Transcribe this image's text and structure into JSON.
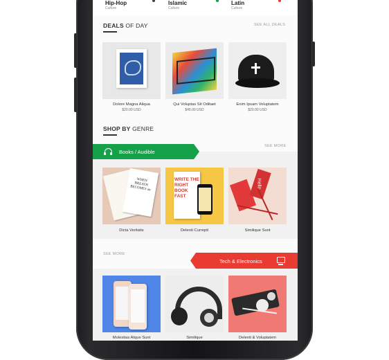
{
  "categories": [
    {
      "title": "Hip-Hop",
      "sub": "Culture"
    },
    {
      "title": "Islamic",
      "sub": "Culture"
    },
    {
      "title": "Latin",
      "sub": "Culture"
    }
  ],
  "deals": {
    "title_bold": "DEALS",
    "title_rest": "OF DAY",
    "see_all": "SEE ALL DEALS",
    "items": [
      {
        "name": "Dolore Magna Aliqua",
        "price": "$20.00 USD"
      },
      {
        "name": "Qui Voluptas Sit Oditaet",
        "price": "$45.00 USD"
      },
      {
        "name": "Enim Ipsam Voluptatem",
        "price": "$20.00 USD"
      }
    ]
  },
  "genre": {
    "title_bold": "SHOP BY",
    "title_rest": "GENRE",
    "books": {
      "label": "Books / Audible",
      "see_more": "SEE MORE",
      "items": [
        {
          "name": "Dicta Veritatis",
          "cover_text": "WHEN BREATH BECOMES air"
        },
        {
          "name": "Delenti Currepti",
          "cover_text": "WRITE THE RIGHT BOOK FAST"
        },
        {
          "name": "Similique Sunt",
          "cover_text": "Hello"
        }
      ]
    },
    "tech": {
      "label": "Tech & Electronics",
      "see_more": "SEE MORE",
      "items": [
        {
          "name": "Molestias Atque Sunt"
        },
        {
          "name": "Similique"
        },
        {
          "name": "Delenti & Voluptatem"
        }
      ]
    }
  },
  "colors": {
    "green_ribbon": "#15a149",
    "red_ribbon": "#ea3b33"
  }
}
